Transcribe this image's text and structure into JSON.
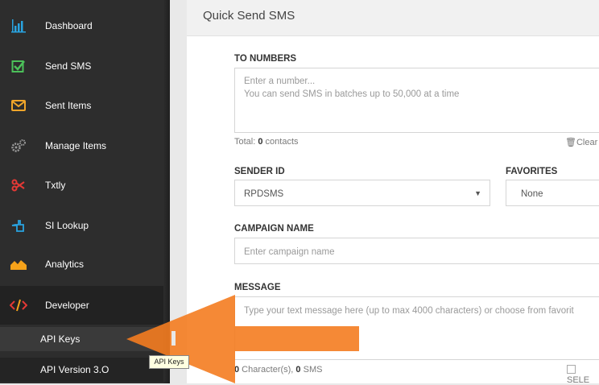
{
  "sidebar": {
    "items": [
      {
        "label": "Dashboard",
        "icon": "bar-chart-icon"
      },
      {
        "label": "Send SMS",
        "icon": "checkbox-icon"
      },
      {
        "label": "Sent Items",
        "icon": "envelope-icon"
      },
      {
        "label": "Manage Items",
        "icon": "gears-icon"
      },
      {
        "label": "Txtly",
        "icon": "scissors-icon"
      },
      {
        "label": "SI Lookup",
        "icon": "pointing-hand-icon"
      },
      {
        "label": "Analytics",
        "icon": "area-chart-icon"
      },
      {
        "label": "Developer",
        "icon": "code-icon"
      }
    ],
    "subitems": [
      {
        "label": "API Keys"
      },
      {
        "label": "API Version 3.O"
      }
    ]
  },
  "tooltip": "API Keys",
  "main": {
    "title": "Quick Send SMS",
    "to_numbers": {
      "label": "TO NUMBERS",
      "placeholder_line1": "Enter a number...",
      "placeholder_line2": "You can send SMS in batches up to 50,000 at a time",
      "total_prefix": "Total: ",
      "total_count": "0",
      "total_suffix": " contacts",
      "clear_label": "Clear"
    },
    "sender_id": {
      "label": "SENDER ID",
      "value": "RPDSMS"
    },
    "favorites": {
      "label": "FAVORITES",
      "value": "None"
    },
    "campaign": {
      "label": "CAMPAIGN NAME",
      "placeholder": "Enter campaign name"
    },
    "message": {
      "label": "MESSAGE",
      "placeholder": "Type your text message here (up to max 4000 characters) or choose from favorit",
      "char_count": "0",
      "char_label": " Character(s), ",
      "sms_count": "0",
      "sms_label": " SMS",
      "select_label": "SELE"
    }
  },
  "colors": {
    "sidebar": "#2d2d2d",
    "arrow": "#f47c20",
    "accent_blue": "#1e88e5"
  }
}
